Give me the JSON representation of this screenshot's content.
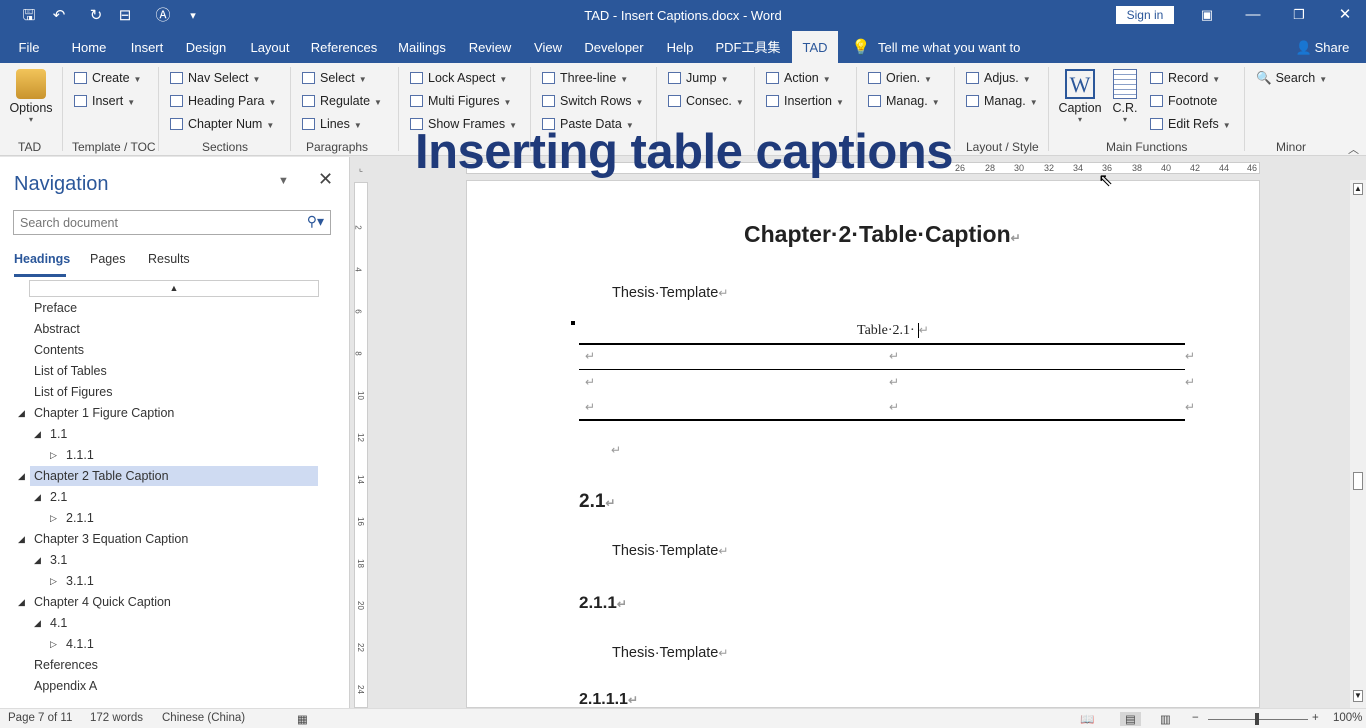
{
  "window": {
    "title": "TAD - Insert Captions.docx - Word",
    "sign_in": "Sign in"
  },
  "tabs": [
    "File",
    "Home",
    "Insert",
    "Design",
    "Layout",
    "References",
    "Mailings",
    "Review",
    "View",
    "Developer",
    "Help",
    "PDF工具集",
    "TAD"
  ],
  "tell_me": "Tell me what you want to do",
  "share": "Share",
  "ribbon": {
    "options": "Options",
    "template": {
      "create": "Create",
      "insert": "Insert"
    },
    "sections": {
      "nav_select": "Nav Select",
      "heading_para": "Heading Para",
      "chapter_num": "Chapter Num"
    },
    "paragraphs": {
      "select": "Select",
      "regulate": "Regulate",
      "lines": "Lines"
    },
    "figures": {
      "lock_aspect": "Lock Aspect",
      "multi_figures": "Multi Figures",
      "show_frames": "Show Frames"
    },
    "tables": {
      "three_line": "Three-line",
      "switch_rows": "Switch Rows",
      "paste_data": "Paste Data"
    },
    "marks": {
      "jump": "Jump",
      "consec": "Consec."
    },
    "fields": {
      "action": "Action",
      "insertion": "Insertion"
    },
    "pages": {
      "orien": "Orien.",
      "manag": "Manag."
    },
    "layout": {
      "adjus": "Adjus.",
      "manag": "Manag."
    },
    "main": {
      "caption": "Caption",
      "cr": "C.R.",
      "record": "Record",
      "footnote": "Footnote",
      "edit_refs": "Edit Refs"
    },
    "minor": {
      "search": "Search"
    },
    "group_labels": {
      "tad": "TAD",
      "template": "Template / TOC",
      "sections": "Sections",
      "paragraphs": "Paragraphs",
      "layout": "Layout / Style",
      "main": "Main Functions",
      "minor": "Minor"
    }
  },
  "overlay_title": "Inserting table captions",
  "nav": {
    "title": "Navigation",
    "search_placeholder": "Search document",
    "tabs": [
      "Headings",
      "Pages",
      "Results"
    ],
    "headings": [
      "Preface",
      "Abstract",
      "Contents",
      "List of Tables",
      "List of Figures",
      "Chapter 1 Figure Caption",
      "1.1",
      "1.1.1",
      "Chapter 2 Table Caption",
      "2.1",
      "2.1.1",
      "Chapter 3 Equation Caption",
      "3.1",
      "3.1.1",
      "Chapter 4 Quick Caption",
      "4.1",
      "4.1.1",
      "References",
      "Appendix A"
    ]
  },
  "ruler": {
    "h_labels": [
      "26",
      "28",
      "30",
      "32",
      "34",
      "36",
      "38",
      "40",
      "42",
      "44",
      "46"
    ],
    "v_labels": [
      "2",
      "4",
      "6",
      "8",
      "10",
      "12",
      "14",
      "16",
      "18",
      "20",
      "22",
      "24"
    ]
  },
  "document": {
    "chapter_title": "Chapter·2·Table·Caption",
    "para1": "Thesis·Template",
    "table_caption": "Table·2.1·",
    "h2": "2.1",
    "para2": "Thesis·Template",
    "h3": "2.1.1",
    "para3": "Thesis·Template",
    "h4": "2.1.1.1",
    "para_mark": "↵"
  },
  "status": {
    "page": "Page 7 of 11",
    "words": "172 words",
    "language": "Chinese (China)",
    "zoom": "100%"
  }
}
